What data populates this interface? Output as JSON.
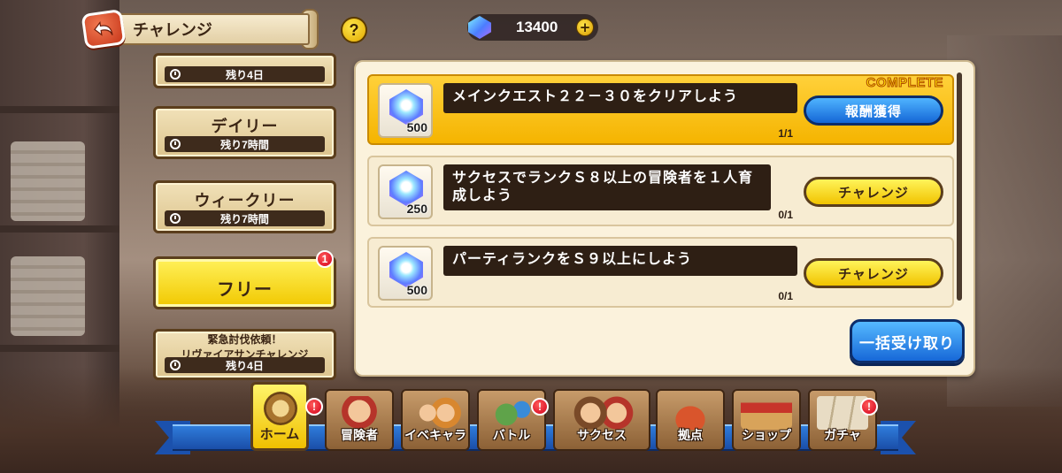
{
  "header": {
    "title": "チャレンジ",
    "help_label": "?",
    "currency": {
      "value": "13400",
      "plus_label": "+"
    }
  },
  "tabs": [
    {
      "label": "",
      "timer": "残り4日"
    },
    {
      "label": "デイリー",
      "timer": "残り7時間"
    },
    {
      "label": "ウィークリー",
      "timer": "残り7時間"
    },
    {
      "label": "フリー",
      "badge": "1",
      "active": true
    },
    {
      "title_line1": "緊急討伐依頼！",
      "title_line2": "リヴァイアサンチャレンジ",
      "timer": "残り4日"
    }
  ],
  "missions": [
    {
      "reward": "500",
      "text": "メインクエスト２２－３０をクリアしよう",
      "progress": "1/1",
      "button": "報酬獲得",
      "complete_label": "COMPLETE"
    },
    {
      "reward": "250",
      "text": "サクセスでランクＳ８以上の冒険者を１人育成しよう",
      "progress": "0/1",
      "button": "チャレンジ"
    },
    {
      "reward": "500",
      "text": "パーティランクをＳ９以上にしよう",
      "progress": "0/1",
      "button": "チャレンジ"
    }
  ],
  "bulk_button": "一括受け取り",
  "nav": [
    {
      "label": "ホーム",
      "badge": "!",
      "active": true
    },
    {
      "label": "冒険者"
    },
    {
      "label": "イベキャラ"
    },
    {
      "label": "バトル",
      "badge": "!"
    },
    {
      "label": "サクセス"
    },
    {
      "label": "拠点"
    },
    {
      "label": "ショップ"
    },
    {
      "label": "ガチャ",
      "badge": "!"
    }
  ],
  "colors": {
    "accent_yellow": "#f1c800",
    "accent_blue": "#1466d6",
    "badge_red": "#d3001a"
  }
}
